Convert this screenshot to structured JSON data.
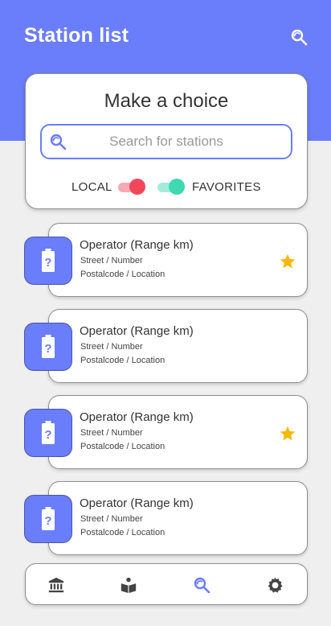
{
  "header": {
    "title": "Station list",
    "search_icon": "search-icon"
  },
  "choice": {
    "title": "Make a choice",
    "search": {
      "placeholder": "Search for stations",
      "value": ""
    },
    "toggles": {
      "local_label": "LOCAL",
      "local_on": true,
      "favorites_label": "FAVORITES",
      "favorites_on": true
    }
  },
  "stations": [
    {
      "name": "Operator (Range km)",
      "street": "Street / Number",
      "postal": "Postalcode / Location",
      "favorite": true,
      "icon": "battery-unknown-icon"
    },
    {
      "name": "Operator (Range km)",
      "street": "Street / Number",
      "postal": "Postalcode / Location",
      "favorite": false,
      "icon": "battery-unknown-icon"
    },
    {
      "name": "Operator (Range km)",
      "street": "Street / Number",
      "postal": "Postalcode / Location",
      "favorite": true,
      "icon": "battery-unknown-icon"
    },
    {
      "name": "Operator (Range km)",
      "street": "Street / Number",
      "postal": "Postalcode / Location",
      "favorite": false,
      "icon": "battery-unknown-icon"
    }
  ],
  "bottom_nav": {
    "items": [
      {
        "icon": "bank-icon",
        "active": false
      },
      {
        "icon": "book-icon",
        "active": false
      },
      {
        "icon": "search-icon",
        "active": true
      },
      {
        "icon": "settings-icon",
        "active": false
      }
    ]
  },
  "colors": {
    "primary": "#6a7dfb",
    "local_toggle": "#f2475a",
    "favorites_toggle": "#3fd9b3",
    "star": "#f6b800",
    "nav_icon": "#444444",
    "nav_icon_active": "#6a7dfb"
  }
}
